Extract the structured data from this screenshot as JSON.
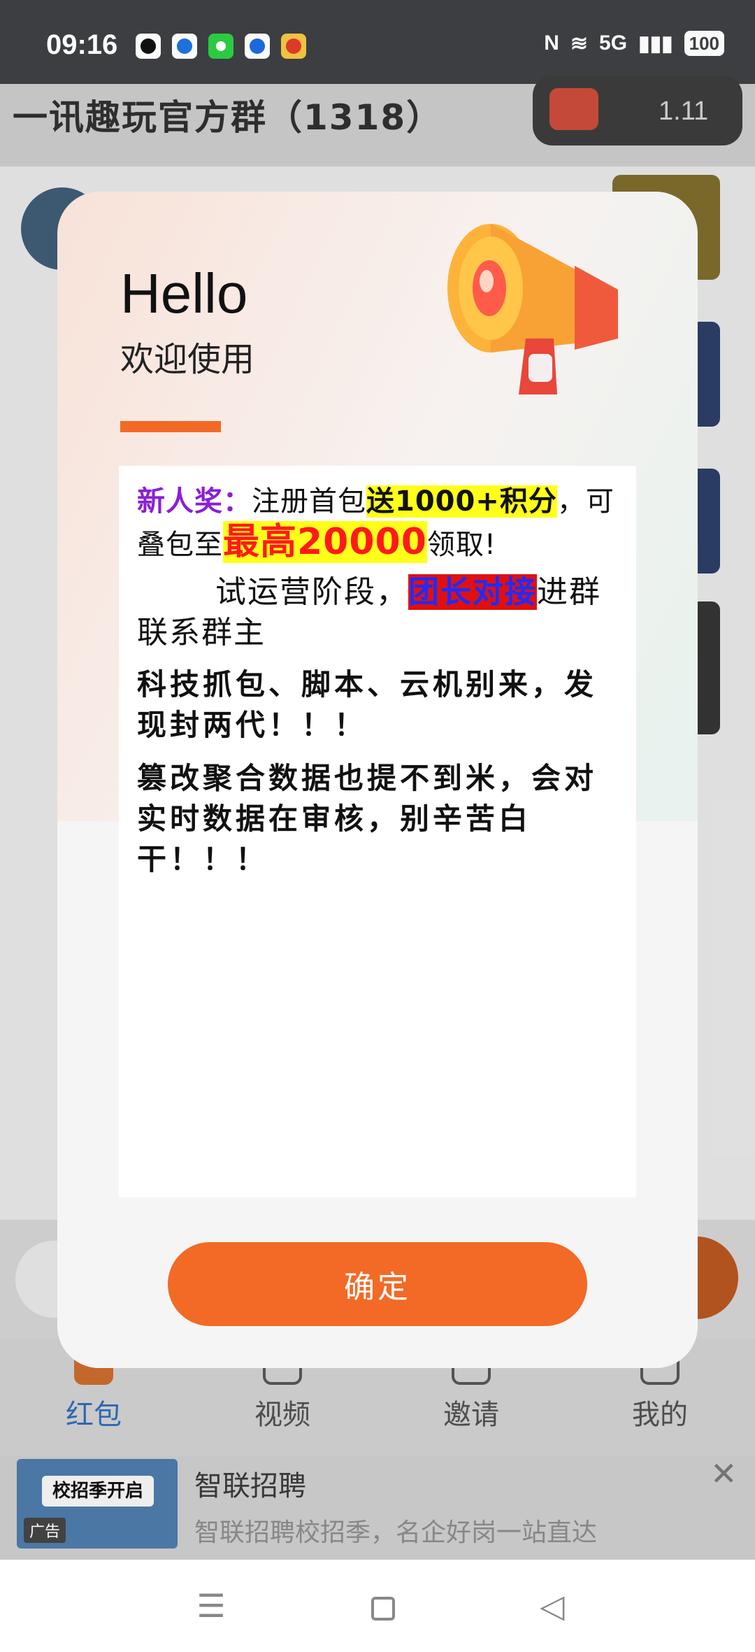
{
  "status_bar": {
    "time": "09:16",
    "network": "5G",
    "battery": "100"
  },
  "background": {
    "group_title": "一讯趣玩官方群（1318）",
    "pill_value": "1.11",
    "tabs": [
      {
        "label": "红包"
      },
      {
        "label": "视频"
      },
      {
        "label": "邀请"
      },
      {
        "label": "我的"
      }
    ],
    "ad": {
      "thumb_text": "校招季开启",
      "label": "广告",
      "title": "智联招聘",
      "subtitle": "智联招聘校招季，名企好岗一站直达"
    }
  },
  "dialog": {
    "hello": "Hello",
    "welcome": "欢迎使用",
    "notice": {
      "p1": {
        "prefix": "新人奖：",
        "text1": "注册首包",
        "highlight1": "送1000+积分",
        "text2": "，可叠包至",
        "highlight2": "最高20000",
        "text3": "领取!"
      },
      "p2": {
        "text1": "试运营阶段，",
        "highlight": "团长对接",
        "text2": "进群联系群主"
      },
      "p3": "科技抓包、脚本、云机别来，发现封两代！！！",
      "p4": "篡改聚合数据也提不到米，会对实时数据在审核，别辛苦白干！！！"
    },
    "confirm_label": "确定"
  },
  "colors": {
    "accent": "#f26a25",
    "purple": "#8b1fd6",
    "highlight_yellow": "#ffff1a",
    "highlight_red_text": "#ff1a1a",
    "highlight_blue_text": "#1d2cff"
  }
}
